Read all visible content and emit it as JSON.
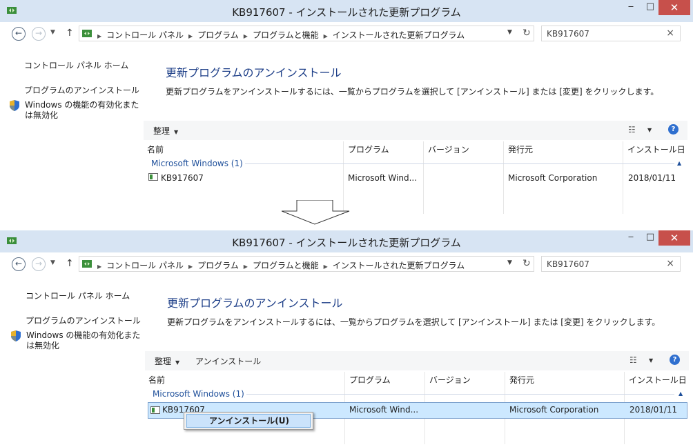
{
  "window": {
    "title": "KB917607 - インストールされた更新プログラム",
    "minimize": "‒",
    "maximize": "□",
    "close": "✕"
  },
  "address": {
    "crumbs": [
      "コントロール パネル",
      "プログラム",
      "プログラムと機能",
      "インストールされた更新プログラム"
    ]
  },
  "search": {
    "value": "KB917607"
  },
  "sidebar": {
    "home": "コントロール パネル ホーム",
    "uninstall_program": "プログラムのアンインストール",
    "windows_features": "Windows の機能の有効化または無効化"
  },
  "main": {
    "heading": "更新プログラムのアンインストール",
    "description": "更新プログラムをアンインストールするには、一覧からプログラムを選択して [アンインストール] または [変更] をクリックします。"
  },
  "toolbar": {
    "organize": "整理",
    "uninstall": "アンインストール"
  },
  "columns": [
    "名前",
    "プログラム",
    "バージョン",
    "発行元",
    "インストール日"
  ],
  "group": {
    "label": "Microsoft Windows (1)"
  },
  "row": {
    "name": "KB917607",
    "program": "Microsoft Wind...",
    "version": "",
    "publisher": "Microsoft Corporation",
    "installed": "2018/01/11"
  },
  "context_menu": {
    "item": "アンインストール(U)"
  },
  "colors": {
    "titlebar": "#d7e4f3",
    "close": "#c7504b",
    "selection": "#cce8ff",
    "heading": "#1e3f88"
  }
}
